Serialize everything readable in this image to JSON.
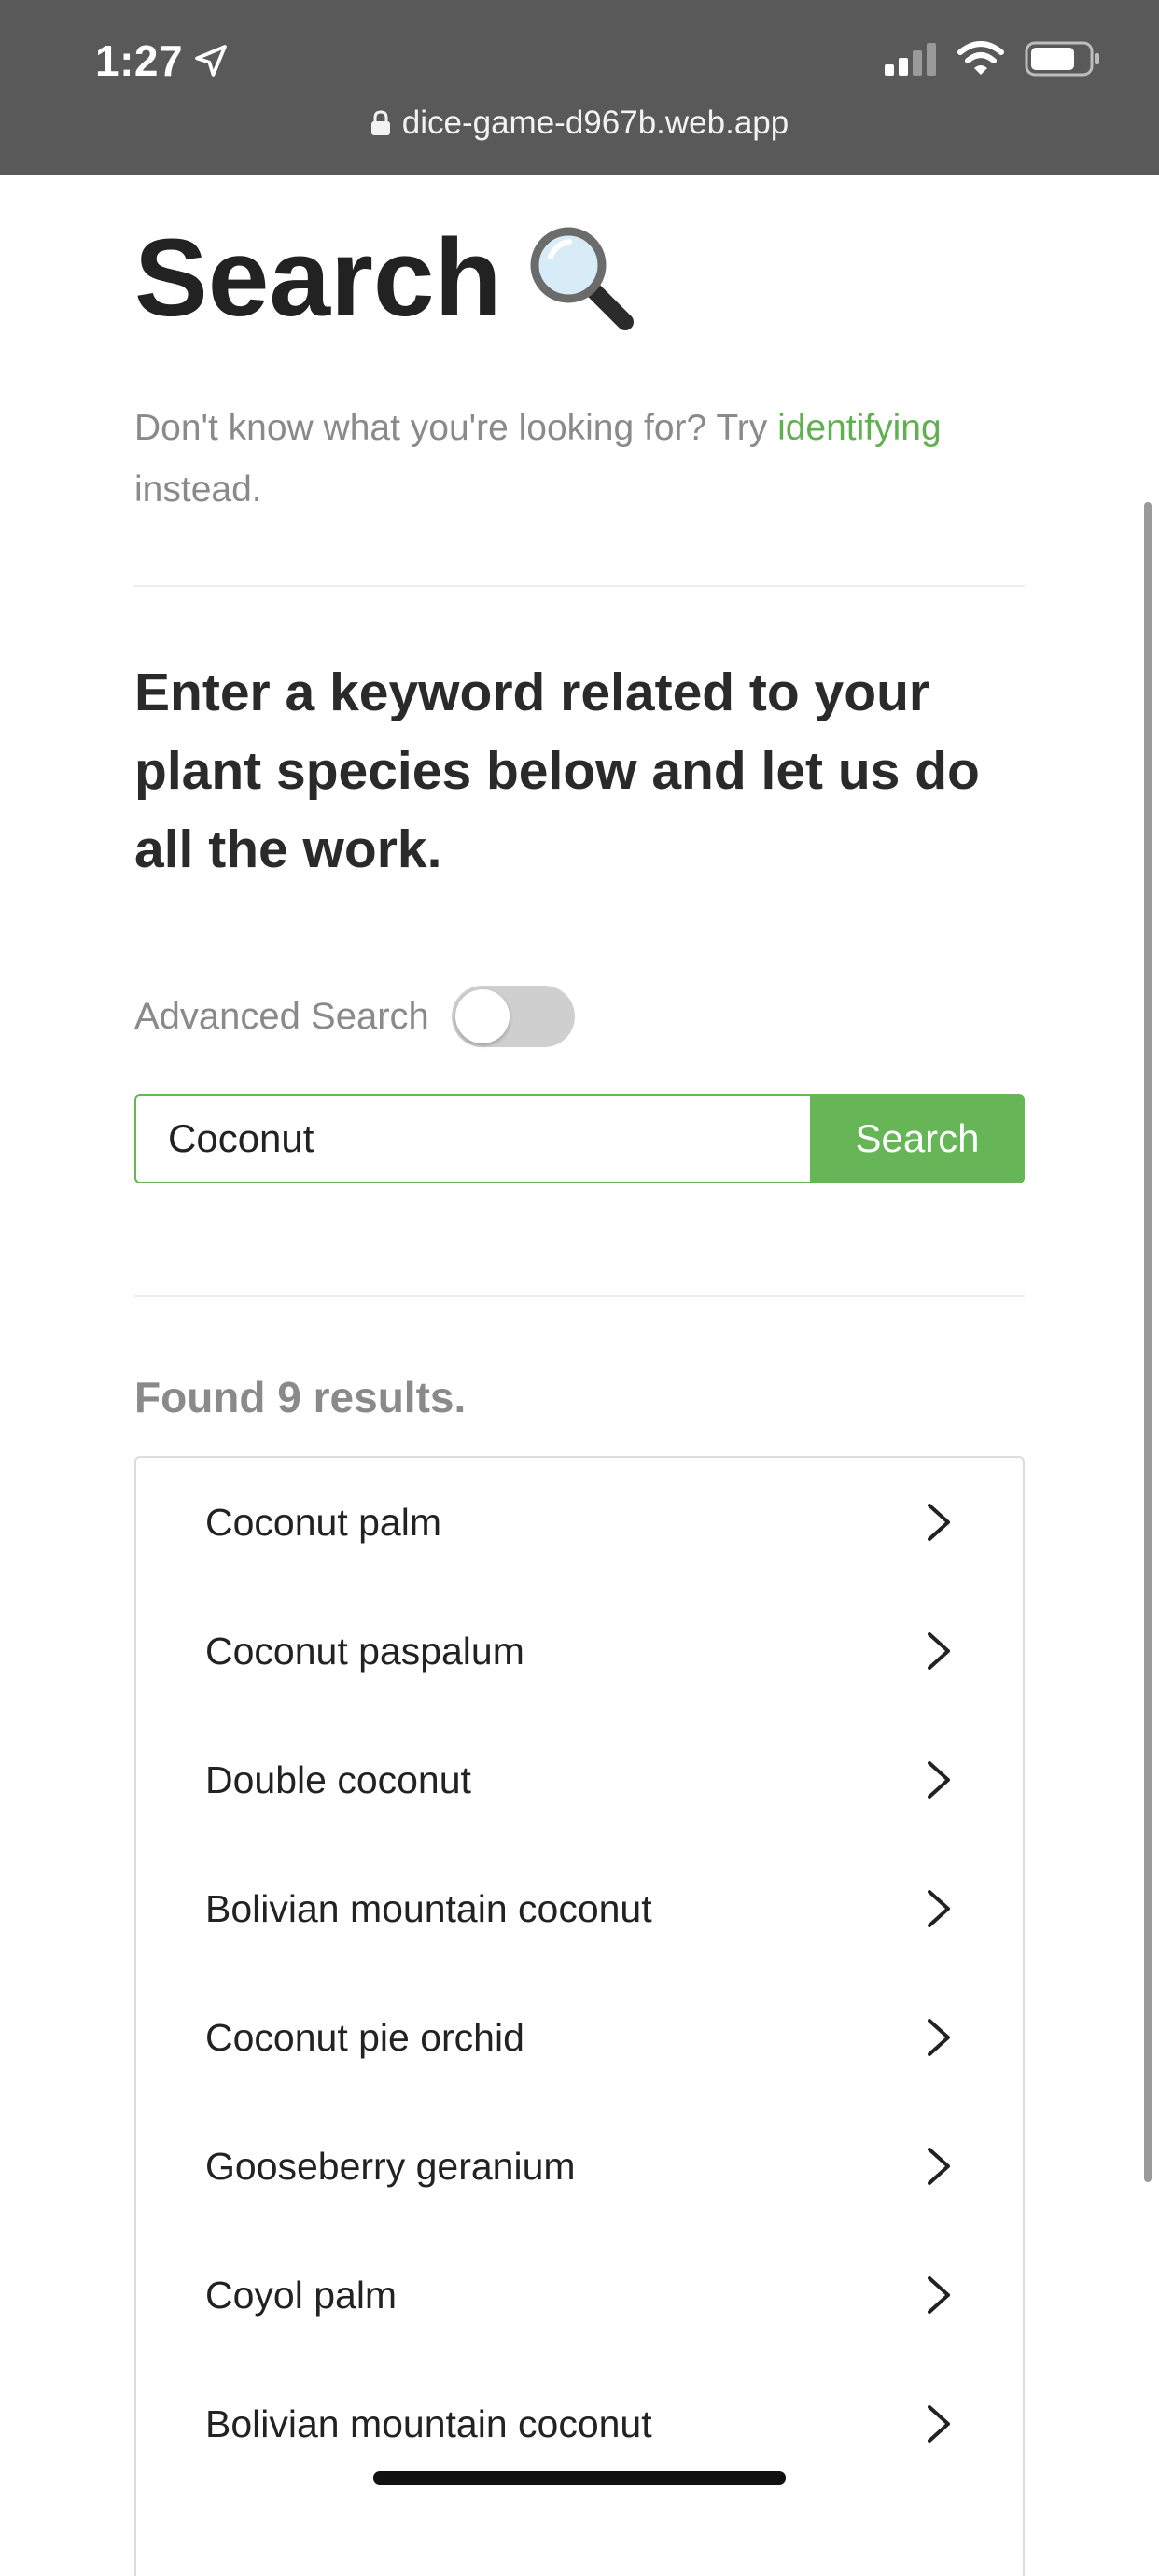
{
  "status_bar": {
    "time": "1:27"
  },
  "browser": {
    "url": "dice-game-d967b.web.app"
  },
  "page": {
    "title": "Search",
    "title_emoji": "🔍",
    "subtitle_prefix": "Don't know what you're looking for? Try",
    "subtitle_link": "identifying",
    "subtitle_suffix": "instead.",
    "heading": "Enter a keyword related to your plant species below and let us do all the work."
  },
  "advanced_search": {
    "label": "Advanced Search",
    "enabled": false
  },
  "search": {
    "value": "Coconut",
    "button_label": "Search"
  },
  "results": {
    "count_text": "Found 9 results.",
    "items": [
      {
        "label": "Coconut palm"
      },
      {
        "label": "Coconut paspalum"
      },
      {
        "label": "Double coconut"
      },
      {
        "label": "Bolivian mountain coconut"
      },
      {
        "label": "Coconut pie orchid"
      },
      {
        "label": "Gooseberry geranium"
      },
      {
        "label": "Coyol palm"
      },
      {
        "label": "Bolivian mountain coconut"
      }
    ]
  },
  "colors": {
    "accent": "#66b556",
    "link": "#5fb04f",
    "topbar": "#595959"
  }
}
